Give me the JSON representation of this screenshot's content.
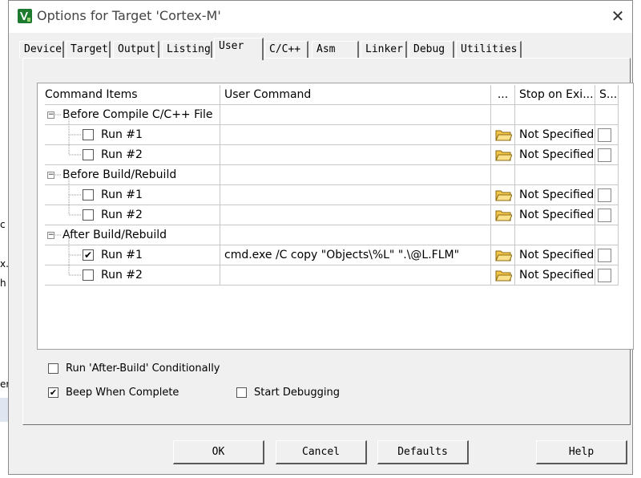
{
  "window": {
    "title": "Options for Target 'Cortex-M'",
    "close_glyph": "✕",
    "app_icon": "keil-uvision-icon"
  },
  "background_window": {
    "fragments": [
      "c",
      "x.",
      "h",
      "er"
    ]
  },
  "tabs": [
    {
      "label": "Device",
      "active": false
    },
    {
      "label": "Target",
      "active": false
    },
    {
      "label": "Output",
      "active": false
    },
    {
      "label": "Listing",
      "active": false
    },
    {
      "label": "User",
      "active": true
    },
    {
      "label": "C/C++",
      "active": false
    },
    {
      "label": "Asm",
      "active": false
    },
    {
      "label": "Linker",
      "active": false
    },
    {
      "label": "Debug",
      "active": false
    },
    {
      "label": "Utilities",
      "active": false
    }
  ],
  "grid": {
    "headers": {
      "command_items": "Command Items",
      "user_command": "User Command",
      "browse": "...",
      "stop_on_exit": "Stop on Exi...",
      "s": "S..."
    },
    "groups": [
      {
        "label": "Before Compile C/C++ File",
        "expander": "−",
        "items": [
          {
            "label": "Run #1",
            "checked": false,
            "command": "",
            "stop": "Not Specified"
          },
          {
            "label": "Run #2",
            "checked": false,
            "command": "",
            "stop": "Not Specified"
          }
        ]
      },
      {
        "label": "Before Build/Rebuild",
        "expander": "−",
        "items": [
          {
            "label": "Run #1",
            "checked": false,
            "command": "",
            "stop": "Not Specified"
          },
          {
            "label": "Run #2",
            "checked": false,
            "command": "",
            "stop": "Not Specified"
          }
        ]
      },
      {
        "label": "After Build/Rebuild",
        "expander": "−",
        "items": [
          {
            "label": "Run #1",
            "checked": true,
            "command": "cmd.exe /C copy \"Objects\\%L\" \".\\@L.FLM\"",
            "stop": "Not Specified"
          },
          {
            "label": "Run #2",
            "checked": false,
            "command": "",
            "stop": "Not Specified"
          }
        ]
      }
    ]
  },
  "options": {
    "run_after_build_conditionally": {
      "label": "Run 'After-Build' Conditionally",
      "checked": false
    },
    "beep_when_complete": {
      "label": "Beep When Complete",
      "checked": true
    },
    "start_debugging": {
      "label": "Start Debugging",
      "checked": false
    }
  },
  "buttons": {
    "ok": "OK",
    "cancel": "Cancel",
    "defaults": "Defaults",
    "help": "Help"
  },
  "checkmark": "✔"
}
